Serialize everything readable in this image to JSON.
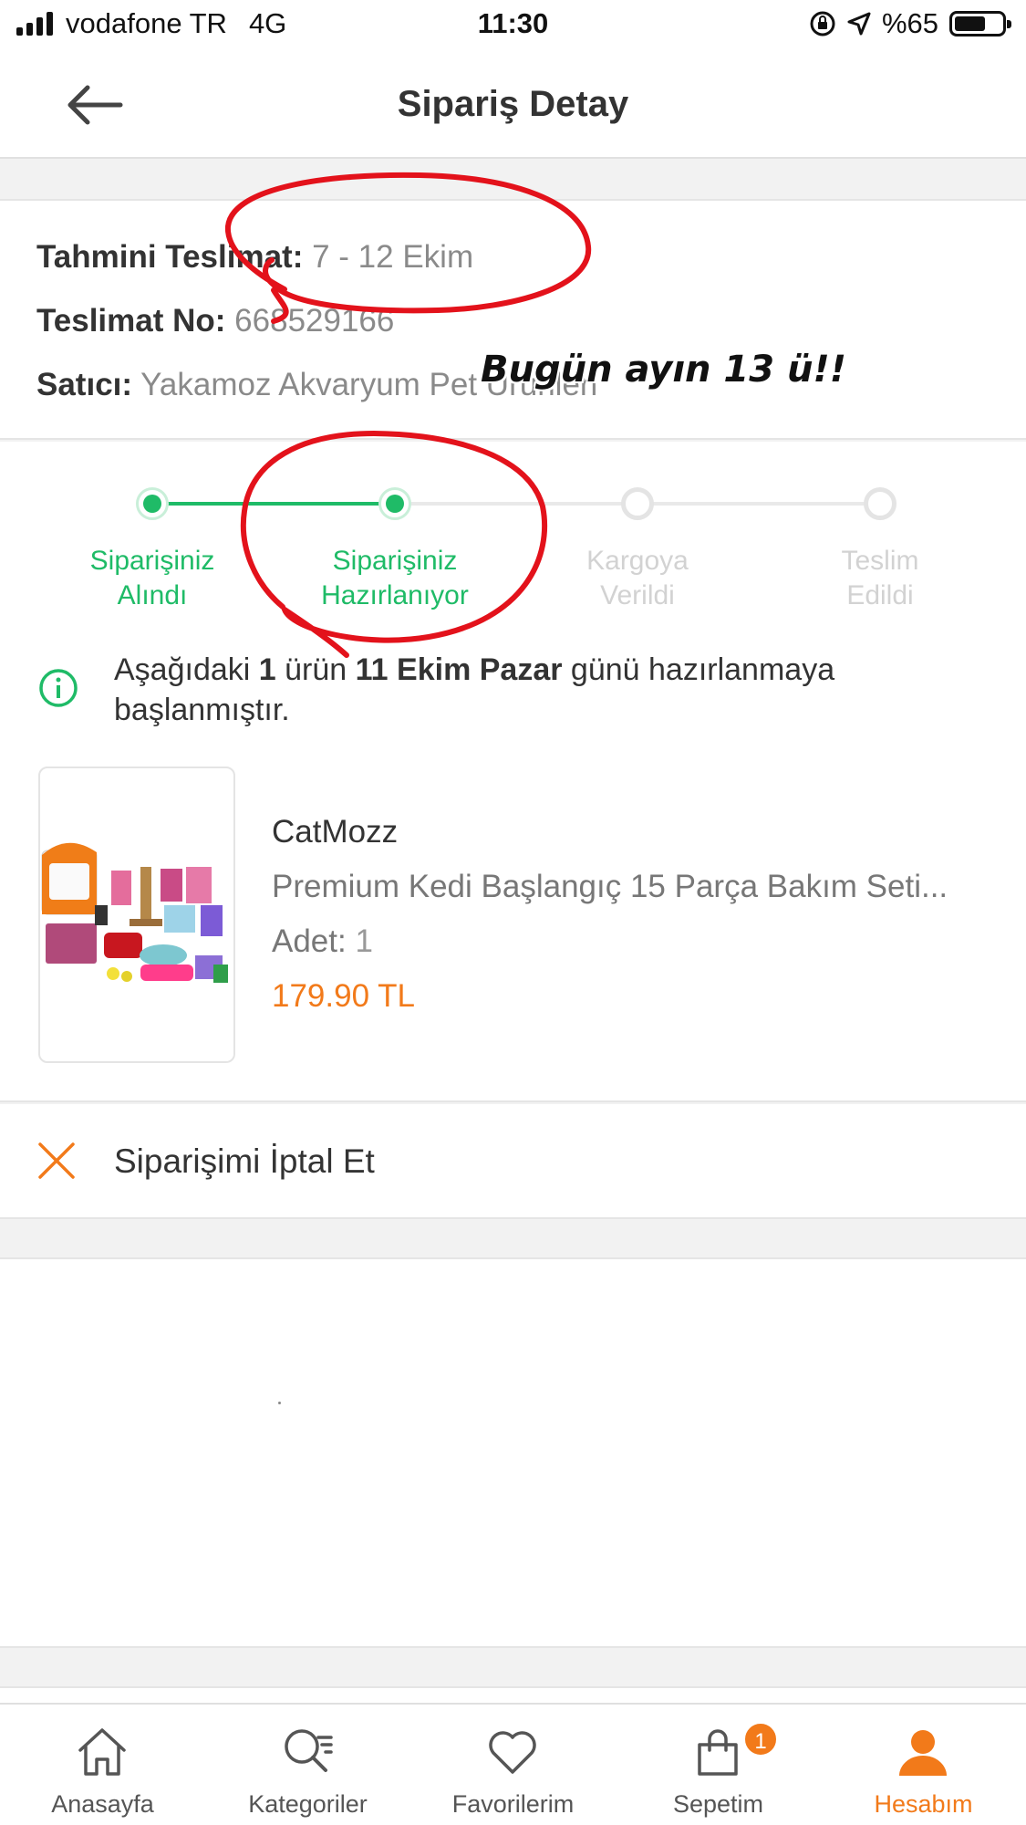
{
  "status_bar": {
    "carrier": "vodafone TR",
    "network": "4G",
    "time": "11:30",
    "battery": "%65",
    "battery_level": 0.65
  },
  "header": {
    "title": "Sipariş Detay",
    "back_icon": "arrow-left-icon"
  },
  "order_info": {
    "delivery_label": "Tahmini Teslimat:",
    "delivery_value": "7 - 12 Ekim",
    "delivery_no_label": "Teslimat No:",
    "delivery_no_value": "668529166",
    "seller_label": "Satıcı:",
    "seller_value": "Yakamoz Akvaryum Pet Ürünleri"
  },
  "tracker": {
    "steps": [
      {
        "line1": "Siparişiniz",
        "line2": "Alındı",
        "state": "done"
      },
      {
        "line1": "Siparişiniz",
        "line2": "Hazırlanıyor",
        "state": "done"
      },
      {
        "line1": "Kargoya",
        "line2": "Verildi",
        "state": "todo"
      },
      {
        "line1": "Teslim",
        "line2": "Edildi",
        "state": "todo"
      }
    ],
    "notice_pre": "Aşağıdaki ",
    "notice_count": "1",
    "notice_mid": " ürün ",
    "notice_date": "11 Ekim Pazar",
    "notice_post": " günü hazırlanmaya başlanmıştır."
  },
  "product": {
    "brand": "CatMozz",
    "name": "Premium Kedi Başlangıç 15 Parça Bakım Seti...",
    "qty_label": "Adet:",
    "qty_value": "1",
    "price": "179.90 TL"
  },
  "cancel": {
    "label": "Siparişimi İptal Et"
  },
  "annotation": {
    "text": "Bugün ayın 13 ü!!"
  },
  "tabbar": {
    "items": [
      {
        "label": "Anasayfa",
        "icon": "home-icon"
      },
      {
        "label": "Kategoriler",
        "icon": "category-search-icon"
      },
      {
        "label": "Favorilerim",
        "icon": "heart-icon"
      },
      {
        "label": "Sepetim",
        "icon": "basket-icon",
        "badge": "1"
      },
      {
        "label": "Hesabım",
        "icon": "user-icon",
        "active": true
      }
    ]
  },
  "colors": {
    "accent": "#f27a1a",
    "success": "#1fbb67",
    "annotation_red": "#e3121b"
  }
}
